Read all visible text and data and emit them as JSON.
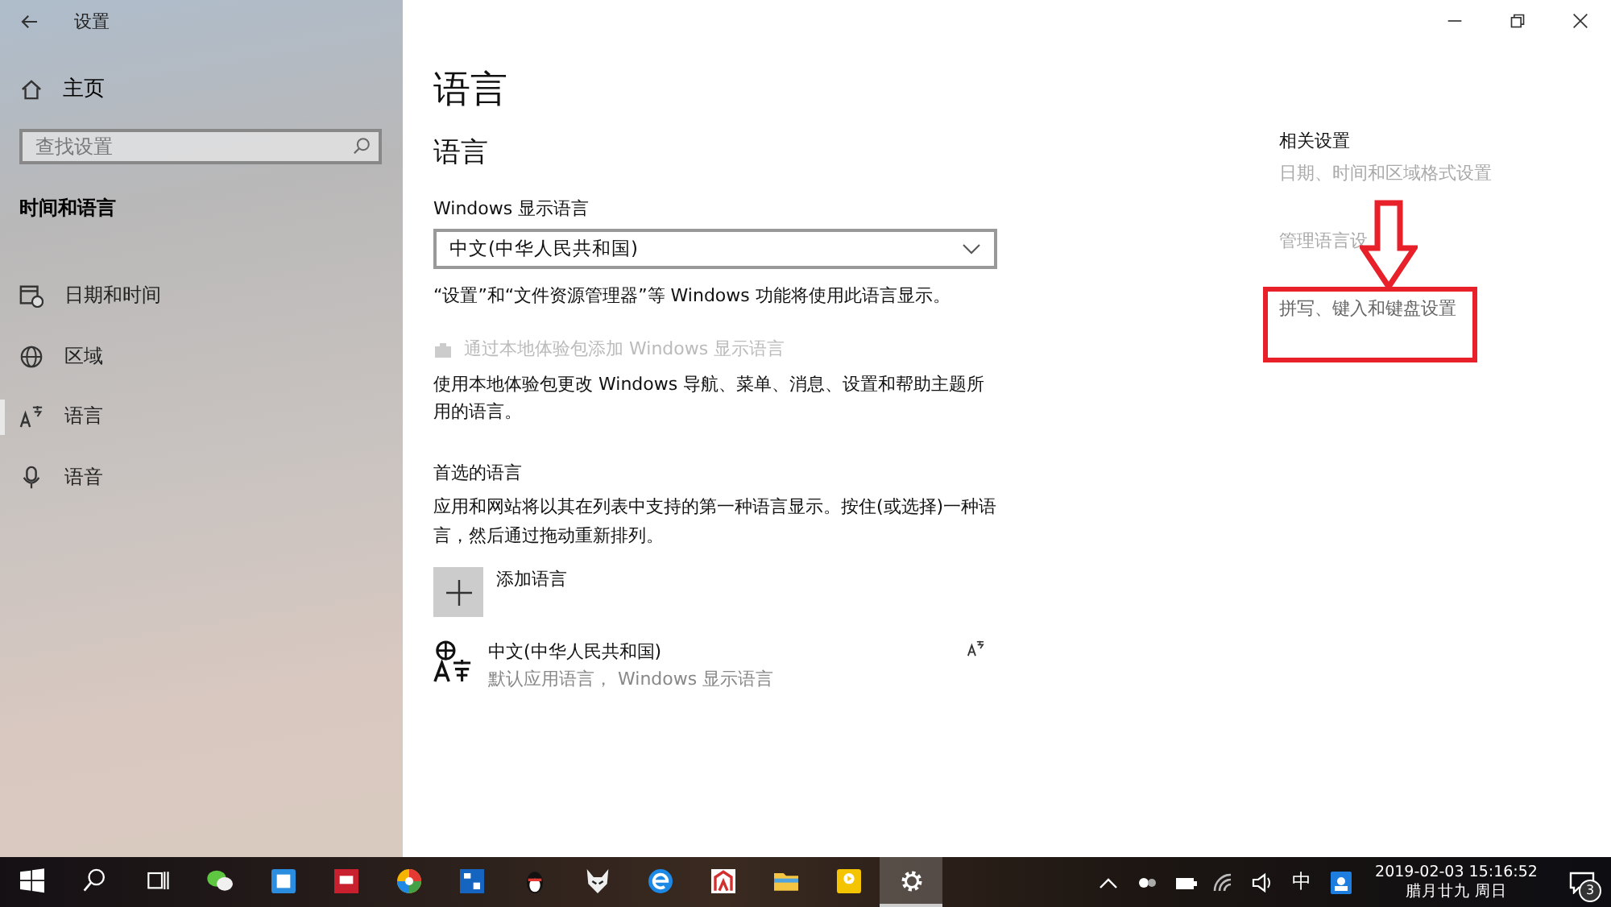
{
  "window": {
    "title": "设置"
  },
  "sidebar": {
    "home": "主页",
    "search": {
      "placeholder": "查找设置"
    },
    "section": "时间和语言",
    "items": [
      {
        "label": "日期和时间",
        "kind": "calendar",
        "selected": false
      },
      {
        "label": "区域",
        "kind": "globe",
        "selected": false
      },
      {
        "label": "语言",
        "kind": "language",
        "selected": true
      },
      {
        "label": "语音",
        "kind": "microphone",
        "selected": false
      }
    ]
  },
  "main": {
    "title": "语言",
    "section": "语言",
    "display_language": {
      "label": "Windows 显示语言",
      "value": "中文(中华人民共和国)"
    },
    "display_note": "“设置”和“文件资源管理器”等 Windows 功能将使用此语言显示。",
    "add_pack": {
      "label": "通过本地体验包添加 Windows 显示语言",
      "disabled": true
    },
    "pack_note": "使用本地体验包更改 Windows 导航、菜单、消息、设置和帮助主题所用的语言。",
    "preferred": {
      "heading": "首选的语言",
      "description": "应用和网站将以其在列表中支持的第一种语言显示。按住(或选择)一种语言，然后通过拖动重新排列。",
      "add_label": "添加语言",
      "languages": [
        {
          "name": "中文(中华人民共和国)",
          "detail": "默认应用语言， Windows 显示语言"
        }
      ]
    }
  },
  "related": {
    "heading": "相关设置",
    "links": [
      {
        "label": "日期、时间和区域格式设置",
        "highlighted": false
      },
      {
        "label": "管理语言设",
        "highlighted": false
      },
      {
        "label": "拼写、键入和键盘设置",
        "highlighted": true
      }
    ]
  },
  "taskbar": {
    "apps": [
      {
        "kind": "start",
        "selected": false
      },
      {
        "kind": "search",
        "selected": false
      },
      {
        "kind": "taskview",
        "selected": false
      },
      {
        "kind": "chat",
        "selected": false
      },
      {
        "kind": "blue-app",
        "selected": false
      },
      {
        "kind": "red-app",
        "selected": false
      },
      {
        "kind": "pinwheel",
        "selected": false
      },
      {
        "kind": "toolbox",
        "selected": false
      },
      {
        "kind": "penguin",
        "selected": false
      },
      {
        "kind": "fox",
        "selected": false
      },
      {
        "kind": "browser",
        "selected": false
      },
      {
        "kind": "red-frame",
        "selected": false
      },
      {
        "kind": "folder",
        "selected": false
      },
      {
        "kind": "player",
        "selected": false
      },
      {
        "kind": "settings",
        "selected": true
      }
    ],
    "ime": "中",
    "time": "2019-02-03 15:16:52",
    "date": "腊月廿九 周日",
    "notifications": "3"
  }
}
